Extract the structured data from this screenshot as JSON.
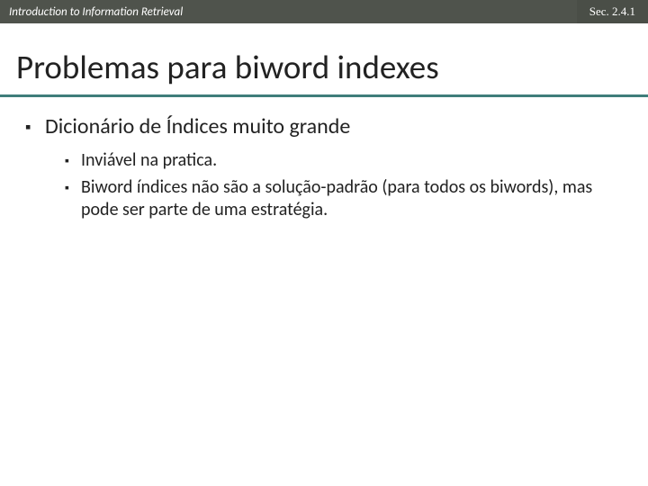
{
  "header": {
    "left": "Introduction to Information Retrieval",
    "right": "Sec. 2.4.1"
  },
  "title": "Problemas para biword indexes",
  "bullets": [
    {
      "text": "Dicionário de Índices muito grande",
      "children": [
        {
          "text": "Inviável na pratica."
        },
        {
          "text": "Biword índices não são a solução-padrão (para todos os biwords), mas pode ser parte de uma estratégia."
        }
      ]
    }
  ]
}
